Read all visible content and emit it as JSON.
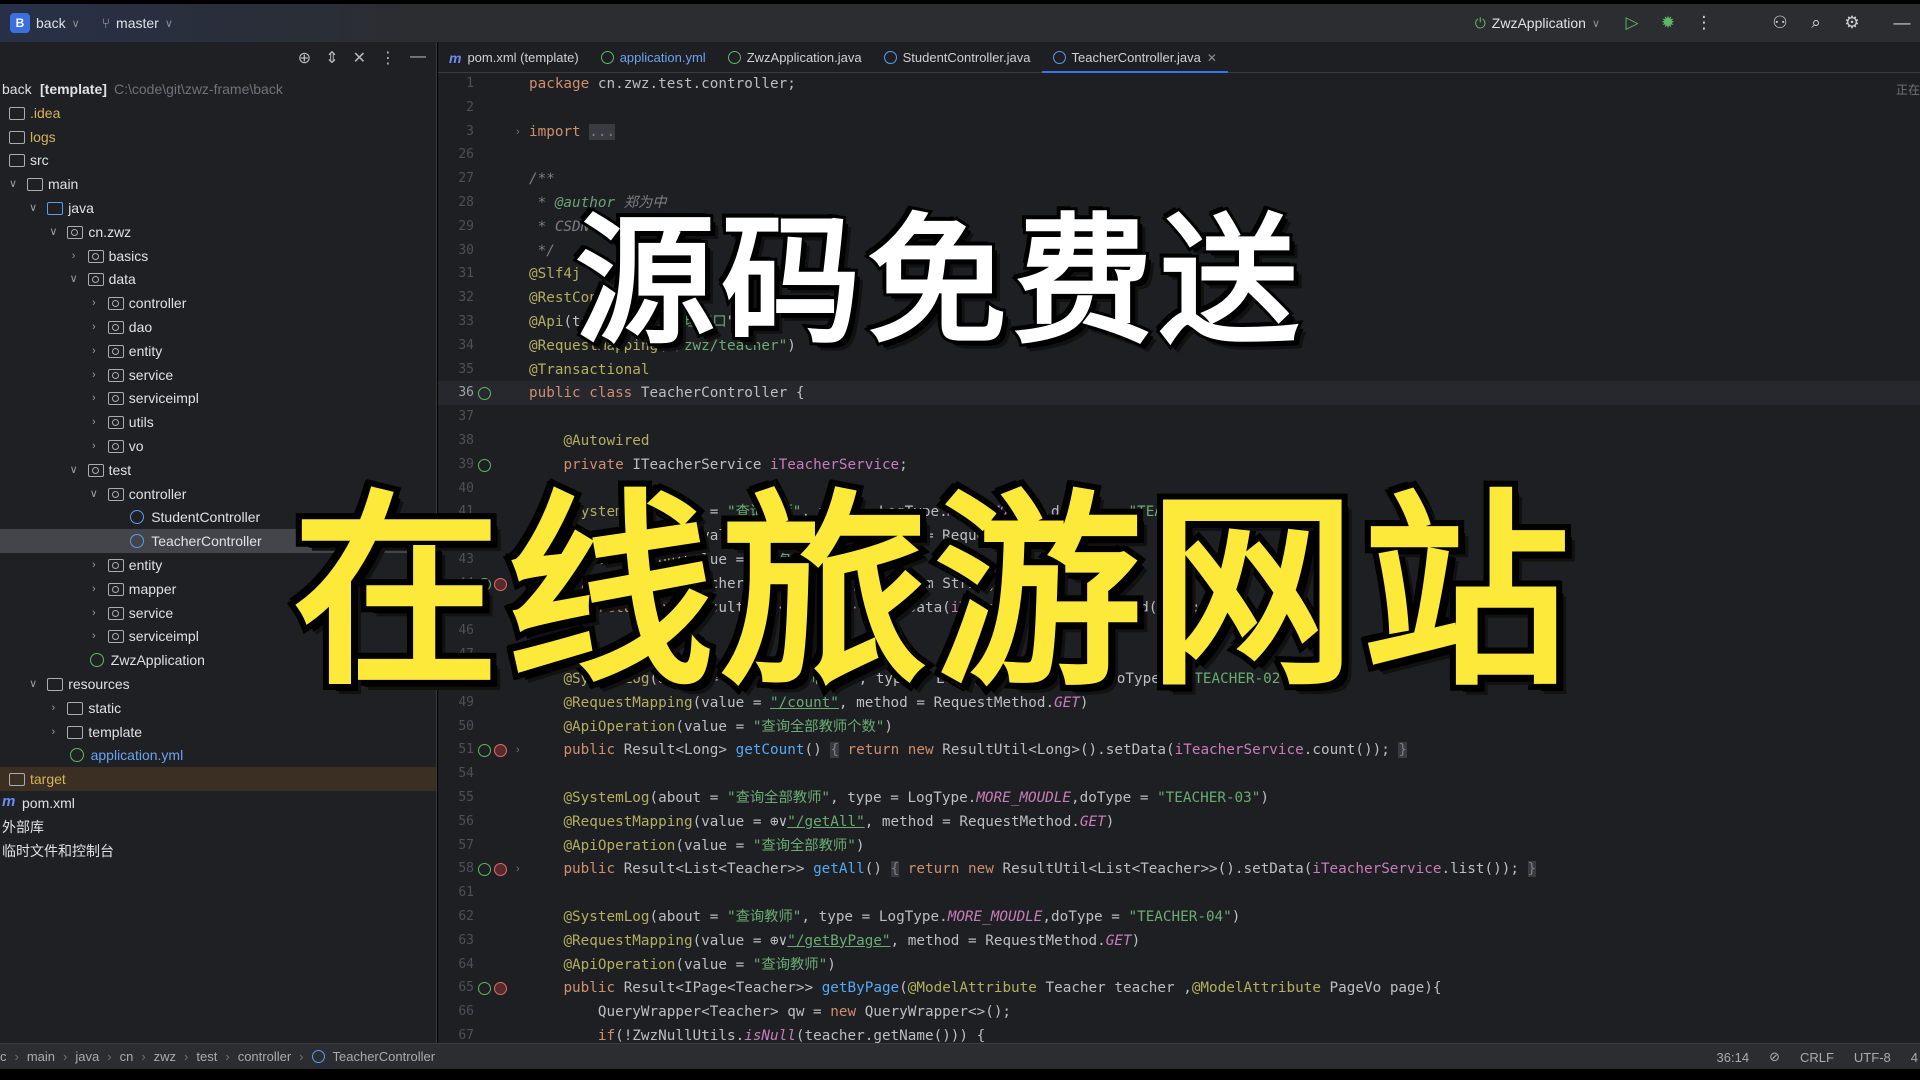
{
  "titlebar": {
    "project_badge": "B",
    "project": "back",
    "branch": "master",
    "run_config": "ZwzApplication"
  },
  "sidebar": {
    "items": [
      {
        "label": "back",
        "bold": "[template]",
        "path": "C:\\code\\git\\zwz-frame\\back",
        "level": 0,
        "icon": "none",
        "chev": "none"
      },
      {
        "label": ".idea",
        "level": 0,
        "icon": "folder",
        "chev": "none",
        "color": "#d6b35c"
      },
      {
        "label": "logs",
        "level": 0,
        "icon": "folder",
        "chev": "none",
        "color": "#d6b35c"
      },
      {
        "label": "src",
        "level": 0,
        "icon": "folder",
        "chev": "none"
      },
      {
        "label": "main",
        "level": 0,
        "icon": "folder",
        "chev": "open"
      },
      {
        "label": "java",
        "level": 1,
        "icon": "folder-blue",
        "chev": "open"
      },
      {
        "label": "cn.zwz",
        "level": 2,
        "icon": "package",
        "chev": "open"
      },
      {
        "label": "basics",
        "level": 3,
        "icon": "package",
        "chev": "closed"
      },
      {
        "label": "data",
        "level": 3,
        "icon": "package",
        "chev": "open"
      },
      {
        "label": "controller",
        "level": 4,
        "icon": "package",
        "chev": "closed"
      },
      {
        "label": "dao",
        "level": 4,
        "icon": "package",
        "chev": "closed"
      },
      {
        "label": "entity",
        "level": 4,
        "icon": "package",
        "chev": "closed"
      },
      {
        "label": "service",
        "level": 4,
        "icon": "package",
        "chev": "closed"
      },
      {
        "label": "serviceimpl",
        "level": 4,
        "icon": "package",
        "chev": "closed"
      },
      {
        "label": "utils",
        "level": 4,
        "icon": "package",
        "chev": "closed"
      },
      {
        "label": "vo",
        "level": 4,
        "icon": "package",
        "chev": "closed"
      },
      {
        "label": "test",
        "level": 3,
        "icon": "package",
        "chev": "open"
      },
      {
        "label": "controller",
        "level": 4,
        "icon": "package",
        "chev": "open"
      },
      {
        "label": "StudentController",
        "level": 6,
        "icon": "class",
        "chev": "none"
      },
      {
        "label": "TeacherController",
        "level": 6,
        "icon": "class",
        "chev": "none",
        "selected": true
      },
      {
        "label": "entity",
        "level": 4,
        "icon": "package",
        "chev": "closed"
      },
      {
        "label": "mapper",
        "level": 4,
        "icon": "package",
        "chev": "closed"
      },
      {
        "label": "service",
        "level": 4,
        "icon": "package",
        "chev": "closed"
      },
      {
        "label": "serviceimpl",
        "level": 4,
        "icon": "package",
        "chev": "closed"
      },
      {
        "label": "ZwzApplication",
        "level": 4,
        "icon": "spring",
        "chev": "none"
      },
      {
        "label": "resources",
        "level": 1,
        "icon": "folder",
        "chev": "open"
      },
      {
        "label": "static",
        "level": 2,
        "icon": "folder",
        "chev": "closed"
      },
      {
        "label": "template",
        "level": 2,
        "icon": "folder",
        "chev": "closed"
      },
      {
        "label": "application.yml",
        "level": 3,
        "icon": "spring",
        "chev": "none",
        "color": "#6aa3f0"
      },
      {
        "label": "target",
        "level": 0,
        "icon": "folder",
        "chev": "none",
        "color": "#d6b35c",
        "excluded": true
      },
      {
        "label": "pom.xml",
        "level": 0,
        "icon": "maven",
        "chev": "none"
      },
      {
        "label": "外部库",
        "level": 0,
        "icon": "none",
        "chev": "none"
      },
      {
        "label": "临时文件和控制台",
        "level": 0,
        "icon": "none",
        "chev": "none"
      }
    ]
  },
  "tabs": [
    {
      "label": "pom.xml (template)",
      "icon": "maven"
    },
    {
      "label": "application.yml",
      "icon": "spring",
      "color": "#6aa3f0"
    },
    {
      "label": "ZwzApplication.java",
      "icon": "spring-class"
    },
    {
      "label": "StudentController.java",
      "icon": "class"
    },
    {
      "label": "TeacherController.java",
      "icon": "class",
      "active": true
    }
  ],
  "editor": {
    "current_line": "36",
    "right_hint": "正在",
    "lines": [
      {
        "n": "1",
        "t": [
          [
            "package ",
            "k"
          ],
          [
            "cn.zwz.test.controller;",
            ""
          ]
        ]
      },
      {
        "n": "2",
        "t": []
      },
      {
        "n": "3",
        "fold": true,
        "t": [
          [
            "import ",
            "k"
          ],
          [
            "...",
            "fold"
          ]
        ]
      },
      {
        "n": "26",
        "t": []
      },
      {
        "n": "27",
        "t": [
          [
            "/**",
            "c"
          ]
        ]
      },
      {
        "n": "28",
        "t": [
          [
            " * ",
            "c"
          ],
          [
            "@author ",
            "d"
          ],
          [
            "郑为中",
            "c"
          ]
        ]
      },
      {
        "n": "29",
        "t": [
          [
            " * CSDN",
            "c"
          ]
        ]
      },
      {
        "n": "30",
        "t": [
          [
            " */",
            "c"
          ]
        ]
      },
      {
        "n": "31",
        "t": [
          [
            "@Slf4j",
            "a"
          ]
        ]
      },
      {
        "n": "32",
        "t": [
          [
            "@RestController",
            "a"
          ]
        ]
      },
      {
        "n": "33",
        "t": [
          [
            "@Api",
            "a"
          ],
          [
            "(tags = \"",
            ""
          ],
          [
            "教师管理接口",
            "s"
          ],
          [
            "\")",
            ""
          ]
        ]
      },
      {
        "n": "34",
        "t": [
          [
            "@RequestMapping",
            "a"
          ],
          [
            "(",
            ""
          ],
          [
            "\"/zwz/teacher\"",
            "s"
          ],
          [
            ")",
            ""
          ]
        ]
      },
      {
        "n": "35",
        "t": [
          [
            "@Transactional",
            "a"
          ]
        ]
      },
      {
        "n": "36",
        "g": [
          "green"
        ],
        "t": [
          [
            "public class ",
            "k"
          ],
          [
            "TeacherController",
            ""
          ],
          [
            " {",
            ""
          ]
        ]
      },
      {
        "n": "37",
        "t": []
      },
      {
        "n": "38",
        "t": [
          [
            "    ",
            ""
          ],
          [
            "@Autowired",
            "a"
          ]
        ]
      },
      {
        "n": "39",
        "g": [
          "green"
        ],
        "t": [
          [
            "    ",
            ""
          ],
          [
            "private ",
            "k"
          ],
          [
            "ITeacherService ",
            ""
          ],
          [
            "iTeacherService",
            "f"
          ],
          [
            ";",
            ""
          ]
        ]
      },
      {
        "n": "40",
        "t": []
      },
      {
        "n": "41",
        "t": [
          [
            "    ",
            ""
          ],
          [
            "@SystemLog",
            "a"
          ],
          [
            "(about = ",
            ""
          ],
          [
            "\"查询教师\"",
            "s"
          ],
          [
            ", type = LogType.",
            ""
          ],
          [
            "MORE_MOUDLE",
            "i"
          ],
          [
            ",doType = ",
            ""
          ],
          [
            "\"TEACHER-01\"",
            "s"
          ],
          [
            ")",
            ""
          ]
        ]
      },
      {
        "n": "42",
        "t": [
          [
            "    ",
            ""
          ],
          [
            "@RequestMapping",
            "a"
          ],
          [
            "(value = ",
            ""
          ],
          [
            "\"/getOne\"",
            "u"
          ],
          [
            ", method = RequestMethod.",
            ""
          ],
          [
            "GET",
            "i"
          ],
          [
            ")",
            ""
          ]
        ]
      },
      {
        "n": "43",
        "t": [
          [
            "    ",
            ""
          ],
          [
            "@ApiOperation",
            "a"
          ],
          [
            "(value = ",
            ""
          ],
          [
            "\"查询单个教师\"",
            "s"
          ],
          [
            ")",
            ""
          ]
        ]
      },
      {
        "n": "44",
        "g": [
          "green",
          "red"
        ],
        "t": [
          [
            "    ",
            ""
          ],
          [
            "public ",
            "k"
          ],
          [
            "Result<Teacher> ",
            ""
          ],
          [
            "getOne",
            "m"
          ],
          [
            "(@RequestParam String id){",
            ""
          ]
        ]
      },
      {
        "n": "45",
        "t": [
          [
            "        ",
            ""
          ],
          [
            "return new ",
            "k"
          ],
          [
            "ResultUtil<Teacher>().setData(",
            ""
          ],
          [
            "iTeacherService",
            "f"
          ],
          [
            ".getById(id));",
            ""
          ]
        ]
      },
      {
        "n": "46",
        "t": [
          [
            "    }",
            ""
          ]
        ]
      },
      {
        "n": "47",
        "t": []
      },
      {
        "n": "48",
        "t": [
          [
            "    ",
            ""
          ],
          [
            "@SystemLog",
            "a"
          ],
          [
            "(about = ",
            ""
          ],
          [
            "\"查询全部教师个数\"",
            "s"
          ],
          [
            ", type = LogType.",
            ""
          ],
          [
            "MORE_MOUDLE",
            "i"
          ],
          [
            ",doType = ",
            ""
          ],
          [
            "\"TEACHER-02\"",
            "s"
          ],
          [
            ")",
            ""
          ]
        ]
      },
      {
        "n": "49",
        "t": [
          [
            "    ",
            ""
          ],
          [
            "@RequestMapping",
            "a"
          ],
          [
            "(value = ",
            ""
          ],
          [
            "\"/count\"",
            "u"
          ],
          [
            ", method = RequestMethod.",
            ""
          ],
          [
            "GET",
            "i"
          ],
          [
            ")",
            ""
          ]
        ]
      },
      {
        "n": "50",
        "t": [
          [
            "    ",
            ""
          ],
          [
            "@ApiOperation",
            "a"
          ],
          [
            "(value = ",
            ""
          ],
          [
            "\"查询全部教师个数\"",
            "s"
          ],
          [
            ")",
            ""
          ]
        ]
      },
      {
        "n": "51",
        "g": [
          "green",
          "red"
        ],
        "fold": true,
        "t": [
          [
            "    ",
            ""
          ],
          [
            "public ",
            "k"
          ],
          [
            "Result<Long> ",
            ""
          ],
          [
            "getCount",
            "m"
          ],
          [
            "() ",
            ""
          ],
          [
            "{",
            "fold"
          ],
          [
            " ",
            ""
          ],
          [
            "return new ",
            "k"
          ],
          [
            "ResultUtil<Long>().setData(",
            ""
          ],
          [
            "iTeacherService",
            "f"
          ],
          [
            ".count()); ",
            ""
          ],
          [
            "}",
            "fold"
          ]
        ]
      },
      {
        "n": "54",
        "t": []
      },
      {
        "n": "55",
        "t": [
          [
            "    ",
            ""
          ],
          [
            "@SystemLog",
            "a"
          ],
          [
            "(about = ",
            ""
          ],
          [
            "\"查询全部教师\"",
            "s"
          ],
          [
            ", type = LogType.",
            ""
          ],
          [
            "MORE_MOUDLE",
            "i"
          ],
          [
            ",doType = ",
            ""
          ],
          [
            "\"TEACHER-03\"",
            "s"
          ],
          [
            ")",
            ""
          ]
        ]
      },
      {
        "n": "56",
        "t": [
          [
            "    ",
            ""
          ],
          [
            "@RequestMapping",
            "a"
          ],
          [
            "(value = ⊕∨",
            ""
          ],
          [
            "\"/getAll\"",
            "u"
          ],
          [
            ", method = RequestMethod.",
            ""
          ],
          [
            "GET",
            "i"
          ],
          [
            ")",
            ""
          ]
        ]
      },
      {
        "n": "57",
        "t": [
          [
            "    ",
            ""
          ],
          [
            "@ApiOperation",
            "a"
          ],
          [
            "(value = ",
            ""
          ],
          [
            "\"查询全部教师\"",
            "s"
          ],
          [
            ")",
            ""
          ]
        ]
      },
      {
        "n": "58",
        "g": [
          "green",
          "red"
        ],
        "fold": true,
        "t": [
          [
            "    ",
            ""
          ],
          [
            "public ",
            "k"
          ],
          [
            "Result<List<Teacher>> ",
            ""
          ],
          [
            "getAll",
            "m"
          ],
          [
            "() ",
            ""
          ],
          [
            "{",
            "fold"
          ],
          [
            " ",
            ""
          ],
          [
            "return new ",
            "k"
          ],
          [
            "ResultUtil<List<Teacher>>().setData(",
            ""
          ],
          [
            "iTeacherService",
            "f"
          ],
          [
            ".list()); ",
            ""
          ],
          [
            "}",
            "fold"
          ]
        ]
      },
      {
        "n": "61",
        "t": []
      },
      {
        "n": "62",
        "t": [
          [
            "    ",
            ""
          ],
          [
            "@SystemLog",
            "a"
          ],
          [
            "(about = ",
            ""
          ],
          [
            "\"查询教师\"",
            "s"
          ],
          [
            ", type = LogType.",
            ""
          ],
          [
            "MORE_MOUDLE",
            "i"
          ],
          [
            ",doType = ",
            ""
          ],
          [
            "\"TEACHER-04\"",
            "s"
          ],
          [
            ")",
            ""
          ]
        ]
      },
      {
        "n": "63",
        "t": [
          [
            "    ",
            ""
          ],
          [
            "@RequestMapping",
            "a"
          ],
          [
            "(value = ⊕∨",
            ""
          ],
          [
            "\"/getByPage\"",
            "u"
          ],
          [
            ", method = RequestMethod.",
            ""
          ],
          [
            "GET",
            "i"
          ],
          [
            ")",
            ""
          ]
        ]
      },
      {
        "n": "64",
        "t": [
          [
            "    ",
            ""
          ],
          [
            "@ApiOperation",
            "a"
          ],
          [
            "(value = ",
            ""
          ],
          [
            "\"查询教师\"",
            "s"
          ],
          [
            ")",
            ""
          ]
        ]
      },
      {
        "n": "65",
        "g": [
          "green",
          "red"
        ],
        "t": [
          [
            "    ",
            ""
          ],
          [
            "public ",
            "k"
          ],
          [
            "Result<IPage<Teacher>> ",
            ""
          ],
          [
            "getByPage",
            "m"
          ],
          [
            "(",
            ""
          ],
          [
            "@ModelAttribute",
            "a"
          ],
          [
            " Teacher teacher ,",
            ""
          ],
          [
            "@ModelAttribute",
            "a"
          ],
          [
            " PageVo page){",
            ""
          ]
        ]
      },
      {
        "n": "66",
        "t": [
          [
            "        QueryWrapper<Teacher> qw = ",
            ""
          ],
          [
            "new ",
            "k"
          ],
          [
            "QueryWrapper<>();",
            ""
          ]
        ]
      },
      {
        "n": "67",
        "t": [
          [
            "        ",
            ""
          ],
          [
            "if",
            "k"
          ],
          [
            "(!ZwzNullUtils.",
            ""
          ],
          [
            "isNull",
            "i"
          ],
          [
            "(teacher.getName())) {",
            ""
          ]
        ]
      }
    ]
  },
  "overlay": {
    "line1": "源码免费送",
    "line2": "在线旅游网站"
  },
  "statusbar": {
    "breadcrumb": [
      "c",
      "main",
      "java",
      "cn",
      "zwz",
      "test",
      "controller",
      "TeacherController"
    ],
    "position": "36:14",
    "line_ending": "CRLF",
    "encoding": "UTF-8",
    "indent": "4"
  },
  "colors": {
    "accent": "#3574f0",
    "overlay_yellow": "#fde93a",
    "overlay_white": "#ffffff"
  }
}
